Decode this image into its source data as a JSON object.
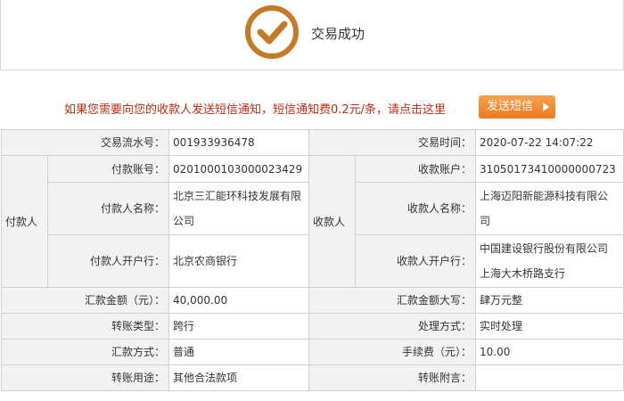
{
  "banner": {
    "title": "交易成功",
    "icon": "check-circle-icon",
    "accent": "#c77a26"
  },
  "notice": {
    "text": "如果您需要向您的收款人发送短信通知，短信通知费0.2元/条，请点击这里",
    "button_label": "发送短信",
    "text_color": "#c8290f",
    "button_color": "#f08a2c"
  },
  "details": {
    "serial_label": "交易流水号：",
    "serial_value": "001933936478",
    "time_label": "交易时间：",
    "time_value": "2020-07-22 14:07:22",
    "payer_group": "付款人",
    "payee_group": "收款人",
    "payer_account_label": "付款账号：",
    "payer_account_value": "0201000103000023429",
    "payee_account_label": "收款账户：",
    "payee_account_value": "31050173410000000723",
    "payer_name_label": "付款人名称：",
    "payer_name_line1": "北京三汇能环科技发展有限",
    "payer_name_line2": "公司",
    "payee_name_label": "收款人名称：",
    "payee_name_line1": "上海迈阳新能源科技有限公",
    "payee_name_line2": "司",
    "payer_bank_label": "付款人开户行：",
    "payer_bank_value": "北京农商银行",
    "payee_bank_label": "收款人开户行：",
    "payee_bank_line1": "中国建设银行股份有限公司",
    "payee_bank_line2": "上海大木桥路支行",
    "amount_label": "汇款金额（元）：",
    "amount_value": "40,000.00",
    "amount_upper_label": "汇款金额大写：",
    "amount_upper_value": "肆万元整",
    "transfer_type_label": "转账类型：",
    "transfer_type_value": "跨行",
    "process_label": "处理方式：",
    "process_value": "实时处理",
    "remit_method_label": "汇款方式：",
    "remit_method_value": "普通",
    "fee_label": "手续费（元）：",
    "fee_value": "10.00",
    "purpose_label": "转账用途：",
    "purpose_value": "其他合法款项",
    "note_label": "转账附言：",
    "note_value": ""
  }
}
